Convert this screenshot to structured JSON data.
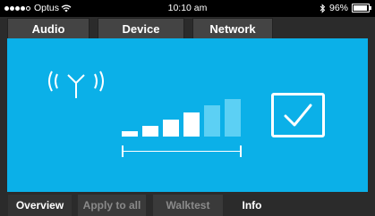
{
  "status_bar": {
    "carrier": "Optus",
    "time": "10:10 am",
    "battery_text": "96%",
    "signal_dots_filled": 4,
    "signal_dots_total": 5,
    "battery_level": 0.96
  },
  "top_tabs": [
    {
      "label": "Audio"
    },
    {
      "label": "Device"
    },
    {
      "label": "Network"
    }
  ],
  "main": {
    "background_color": "#0bb0e8",
    "signal_strength_bars_total": 6,
    "signal_strength_bars_filled": 4
  },
  "bottom_tabs": [
    {
      "label": "Overview",
      "enabled": true
    },
    {
      "label": "Apply to all",
      "enabled": false
    },
    {
      "label": "Walktest",
      "enabled": false
    },
    {
      "label": "Info",
      "enabled": true
    }
  ],
  "colors": {
    "accent_blue": "#0bb0e8",
    "bar_filled": "#ffffff",
    "bar_unfilled": "#5cd0f4"
  }
}
